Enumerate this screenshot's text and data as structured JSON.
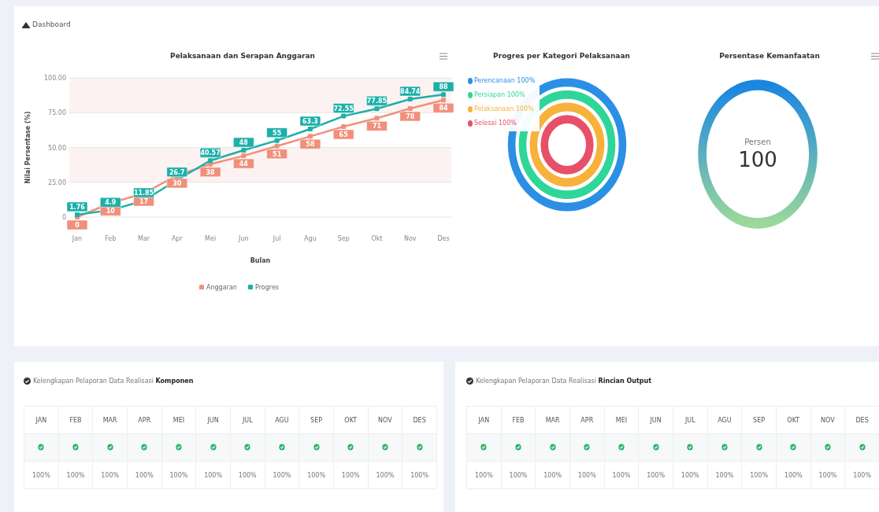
{
  "breadcrumb": "Dashboard",
  "line_panel": {
    "title": "Pelaksanaan dan Serapan Anggaran",
    "chart_data": {
      "type": "line",
      "xlabel": "Bulan",
      "ylabel": "Nilai Persentase (%)",
      "categories": [
        "Jan",
        "Feb",
        "Mar",
        "Apr",
        "Mei",
        "Jun",
        "Jul",
        "Agu",
        "Sep",
        "Okt",
        "Nov",
        "Des"
      ],
      "ylim": [
        0,
        100
      ],
      "yticks": [
        {
          "value": 0,
          "label": "0"
        },
        {
          "value": 25,
          "label": "25.00"
        },
        {
          "value": 50,
          "label": "50.00"
        },
        {
          "value": 75,
          "label": "75.00"
        },
        {
          "value": 100,
          "label": "100.00"
        }
      ],
      "grid": true,
      "legend": true,
      "data_labels": true,
      "series": [
        {
          "name": "Anggaran",
          "color": "#f0907a",
          "marker": "square",
          "values": [
            0,
            10,
            17,
            30,
            38,
            44,
            51,
            58,
            65,
            71,
            78,
            84
          ]
        },
        {
          "name": "Progres",
          "color": "#1cb0a8",
          "marker": "square",
          "values": [
            1.76,
            4.9,
            11.85,
            26.7,
            40.57,
            48,
            55,
            63.3,
            72.55,
            77.85,
            84.74,
            88
          ]
        }
      ]
    }
  },
  "radial_panel": {
    "title": "Progres per Kategori Pelaksanaan",
    "categories": [
      {
        "label": "Perencanaan 100%",
        "color": "#2b8fe6",
        "level": 1
      },
      {
        "label": "Persiapan 100%",
        "color": "#2fd699",
        "level": 1
      },
      {
        "label": "Pelaksanaan 100%",
        "color": "#f7b23b",
        "level": 1
      },
      {
        "label": "Selesai 100%",
        "color": "#e8506a",
        "level": 1
      }
    ]
  },
  "gauge_panel": {
    "title": "Persentase Kemanfaatan",
    "caption": "Persen",
    "value": "100",
    "level": 1
  },
  "tables": [
    {
      "title": "Kelengkapan Pelaporan Data Realisasi **Komponen**",
      "months": [
        {
          "label": "JAN",
          "done": true,
          "percent": "100%"
        },
        {
          "label": "FEB",
          "done": true,
          "percent": "100%"
        },
        {
          "label": "MAR",
          "done": true,
          "percent": "100%"
        },
        {
          "label": "APR",
          "done": true,
          "percent": "100%"
        },
        {
          "label": "MEI",
          "done": true,
          "percent": "100%"
        },
        {
          "label": "JUN",
          "done": true,
          "percent": "100%"
        },
        {
          "label": "JUL",
          "done": true,
          "percent": "100%"
        },
        {
          "label": "AGU",
          "done": true,
          "percent": "100%"
        },
        {
          "label": "SEP",
          "done": true,
          "percent": "100%"
        },
        {
          "label": "OKT",
          "done": true,
          "percent": "100%"
        },
        {
          "label": "NOV",
          "done": true,
          "percent": "100%"
        },
        {
          "label": "DES",
          "done": true,
          "percent": "100%"
        }
      ]
    },
    {
      "title": "Kelengkapan Pelaporan Data Realisasi **Rincian Output**",
      "months": [
        {
          "label": "JAN",
          "done": true,
          "percent": "100%"
        },
        {
          "label": "FEB",
          "done": true,
          "percent": "100%"
        },
        {
          "label": "MAR",
          "done": true,
          "percent": "100%"
        },
        {
          "label": "APR",
          "done": true,
          "percent": "100%"
        },
        {
          "label": "MEI",
          "done": true,
          "percent": "100%"
        },
        {
          "label": "JUN",
          "done": true,
          "percent": "100%"
        },
        {
          "label": "JUL",
          "done": true,
          "percent": "100%"
        },
        {
          "label": "AGU",
          "done": true,
          "percent": "100%"
        },
        {
          "label": "SEP",
          "done": true,
          "percent": "100%"
        },
        {
          "label": "OKT",
          "done": true,
          "percent": "100%"
        },
        {
          "label": "NOV",
          "done": true,
          "percent": "100%"
        },
        {
          "label": "DES",
          "done": true,
          "percent": "100%"
        }
      ]
    }
  ]
}
